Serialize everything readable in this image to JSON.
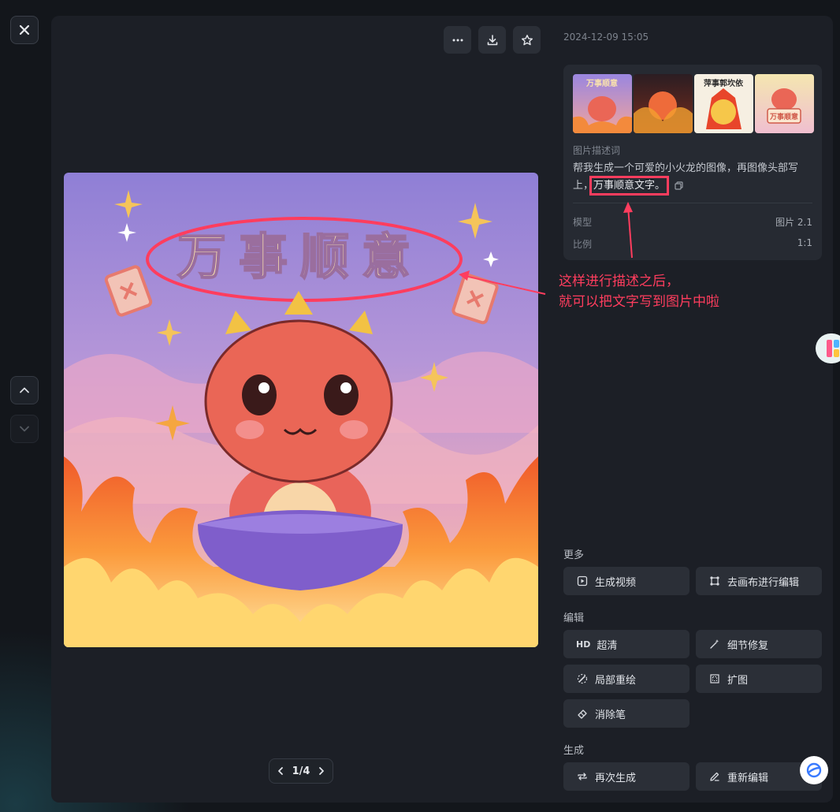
{
  "header": {
    "timestamp": "2024-12-09 15:05"
  },
  "toolbar": {
    "more_icon": "more-icon",
    "download_icon": "download-icon",
    "favorite_icon": "star-icon"
  },
  "main_image": {
    "banner_text": "万事顺意"
  },
  "pager": {
    "label": "1/4"
  },
  "info": {
    "thumbnails": [
      {
        "caption": "万事顺意"
      },
      {
        "caption": ""
      },
      {
        "caption": "萍事郭坎依"
      },
      {
        "caption": "万事顺意"
      }
    ],
    "prompt_label": "图片描述词",
    "prompt_part1": "帮我生成一个可爱的小火龙的图像，再图像头部写上，",
    "prompt_highlight": "万事顺意文字。",
    "model_label": "模型",
    "model_value": "图片 2.1",
    "ratio_label": "比例",
    "ratio_value": "1:1"
  },
  "annotation": {
    "line1": "这样进行描述之后，",
    "line2": "就可以把文字写到图片中啦",
    "color": "#ff3d5e"
  },
  "sections": {
    "more": "更多",
    "edit": "编辑",
    "generate": "生成"
  },
  "actions": {
    "generate_video": "生成视频",
    "canvas_edit": "去画布进行编辑",
    "hd_icon_text": "HD",
    "upscale": "超清",
    "detail_fix": "细节修复",
    "inpaint": "局部重绘",
    "expand": "扩图",
    "eraser": "消除笔",
    "regenerate": "再次生成",
    "reedit": "重新编辑"
  }
}
